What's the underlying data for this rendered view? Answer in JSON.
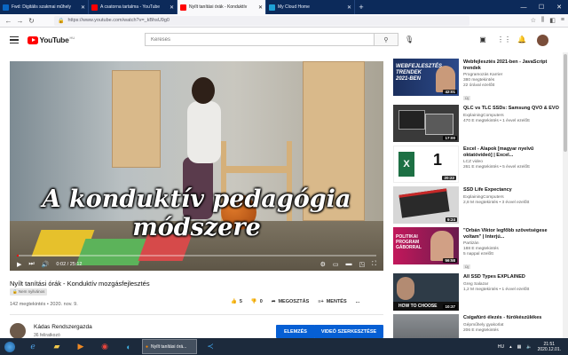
{
  "browser": {
    "tabs": [
      {
        "title": "Fwd: Digitális szakmai műhely",
        "favicon_color": "#0a66c2",
        "active": false
      },
      {
        "title": "A csatorna tartalma - YouTube",
        "favicon_color": "#ff0000",
        "active": false
      },
      {
        "title": "Nyílt tanítási órák - Konduktív",
        "favicon_color": "#ff0000",
        "active": true
      },
      {
        "title": "My Cloud Home",
        "favicon_color": "#1ea0d5",
        "active": false
      }
    ],
    "new_tab": "+",
    "url": "https://www.youtube.com/watch?v=_kBhsU9g0"
  },
  "youtube": {
    "logo_text": "YouTube",
    "logo_region": "HU",
    "search_placeholder": "Keresés",
    "video": {
      "overlay_line1": "A konduktív pedagógia",
      "overlay_line2": "módszere",
      "time": "0:02 / 25:12",
      "progress": 0.0013,
      "title": "Nyílt tanítási órák - Konduktív mozgásfejlesztés",
      "badge": "Nem nyilvános",
      "meta": "142 megtekintés • 2020. nov. 9.",
      "likes": "5",
      "dislikes": "0",
      "share_label": "MEGOSZTÁS",
      "save_label": "MENTÉS",
      "more_label": "..."
    },
    "channel": {
      "name": "Kádas Rendszergazda",
      "subs": "36 feliratkozó",
      "analytics_label": "ELEMZÉS",
      "edit_label": "VIDEÓ SZERKESZTÉSE"
    },
    "sidebar": [
      {
        "title": "Webfejlesztés 2021-ben - JavaScript trendek",
        "channel": "Programozás Karrier",
        "stats1": "380 megtekintés",
        "stats2": "22 órával ezelőtt",
        "new": "Új",
        "duration": "42:01",
        "thumb_text": "WEBFEJLESZTÉS TRENDEK 2021-BEN",
        "thumb_color": "#1b2f5e"
      },
      {
        "title": "QLC vs TLC SSDs: Samsung QVO & EVO",
        "channel": "ExplainingComputers",
        "stats1": "470 E megtekintés • 1 évvel ezelőtt",
        "stats2": "",
        "new": "",
        "duration": "17:00",
        "thumb_text": "",
        "thumb_color": "#3a3a3a"
      },
      {
        "title": "Excel - Alapok [magyar nyelvű oktatóvideó] | Excel...",
        "channel": "LCZ video",
        "stats1": "261 E megtekintés • 5 évvel ezelőtt",
        "stats2": "",
        "new": "",
        "duration": "20:22",
        "thumb_text": "1",
        "thumb_color": "#ffffff"
      },
      {
        "title": "SSD Life Expectancy",
        "channel": "ExplainingComputers",
        "stats1": "2,8 M megtekintés • 3 évvel ezelőtt",
        "stats2": "",
        "new": "",
        "duration": "9:24",
        "thumb_text": "",
        "thumb_color": "#d7d7d7"
      },
      {
        "title": "\"Orbán Viktor legfőbb szövetségese voltam\" | Interjú...",
        "channel": "Partizán",
        "stats1": "188 E megtekintés",
        "stats2": "5 nappal ezelőtt",
        "new": "Új",
        "duration": "56:58",
        "thumb_text": "POLITIKAI PROGRAM GÁBORRAL",
        "thumb_color": "#c2185b"
      },
      {
        "title": "All SSD Types EXPLAINED",
        "channel": "Greg Salazar",
        "stats1": "1,2 M megtekintés • 1 évvel ezelőtt",
        "stats2": "",
        "new": "",
        "duration": "10:37",
        "thumb_text": "HOW TO CHOOSE",
        "thumb_color": "#2e3b47"
      },
      {
        "title": "Csigafúró élezés - fúrókészülékes",
        "channel": "Gépműhely gyakorlat",
        "stats1": "206 E megtekintés",
        "stats2": "",
        "new": "",
        "duration": "",
        "thumb_text": "",
        "thumb_color": "#8b8f93"
      }
    ]
  },
  "taskbar": {
    "active_task": "Nyílt tanítási órá...",
    "lang": "HU",
    "time": "21:51",
    "date": "2020.12.01."
  },
  "colors": {
    "youtube_red": "#ff0000",
    "link_blue": "#065fd4",
    "tabbar_bg": "#0c2a5a"
  }
}
